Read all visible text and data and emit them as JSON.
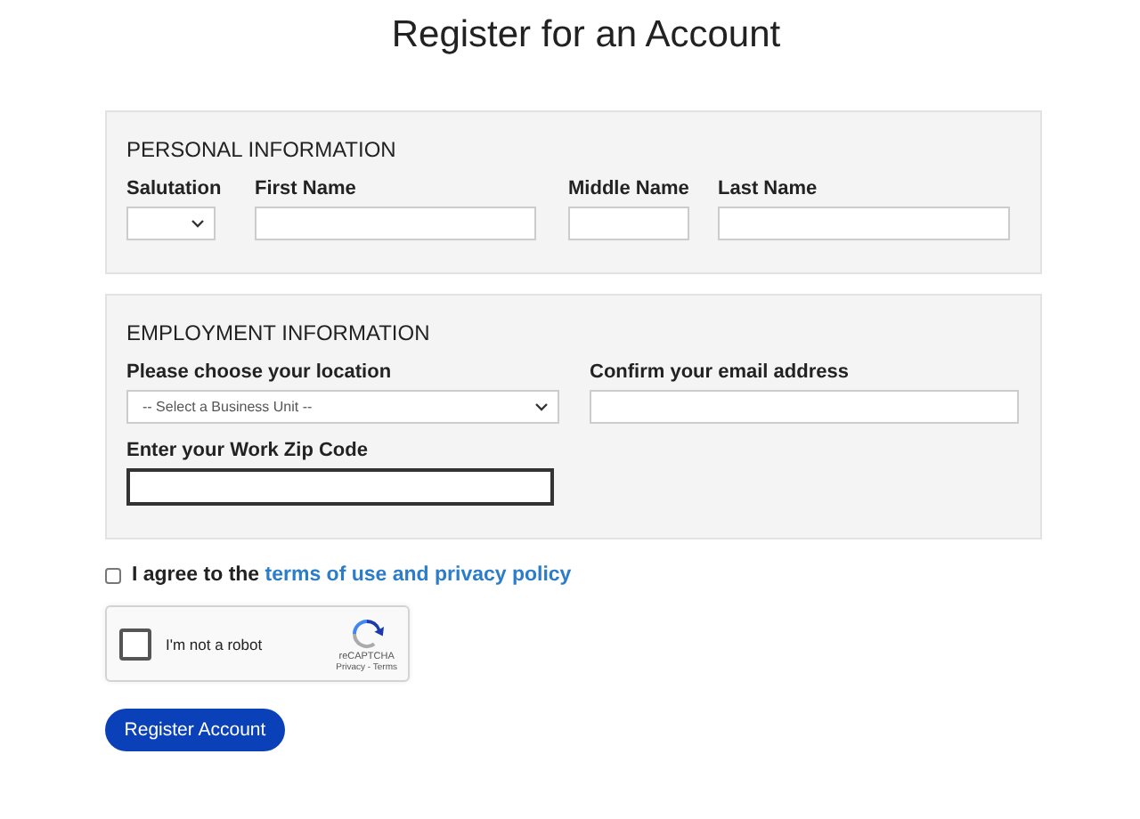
{
  "title": "Register for an Account",
  "personal": {
    "heading": "PERSONAL INFORMATION",
    "fields": [
      {
        "label": "Salutation",
        "kind": "select"
      },
      {
        "label": "First Name",
        "kind": "text",
        "focused": false
      },
      {
        "label": "Middle Name",
        "kind": "text",
        "focused": false
      },
      {
        "label": "Last Name",
        "kind": "text",
        "focused": false
      }
    ]
  },
  "employment": {
    "heading": "EMPLOYMENT INFORMATION",
    "fields": [
      {
        "label": "Please choose your location",
        "kind": "select",
        "placeholder": "-- Select a Business Unit --"
      },
      {
        "label": "Confirm your email address",
        "kind": "text",
        "focused": false
      },
      {
        "label": "Enter your Work Zip Code",
        "kind": "text",
        "focused": true
      }
    ]
  },
  "agree": {
    "text": "I agree to the",
    "link": "terms of use and privacy policy",
    "checked": false
  },
  "captcha": {
    "label": "I'm not a robot",
    "brand": "reCAPTCHA",
    "links": "Privacy - Terms",
    "checked": false
  },
  "button": "Register Account"
}
